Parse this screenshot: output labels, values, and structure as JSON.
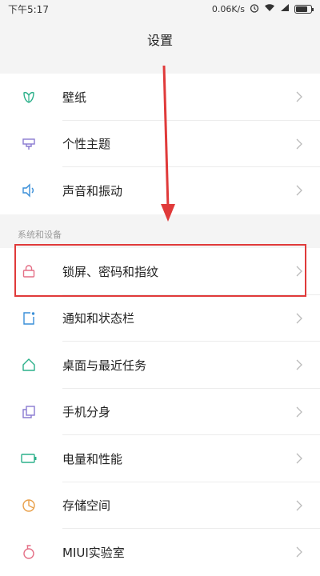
{
  "status_bar": {
    "time": "下午5:17",
    "network_speed": "0.06K/s",
    "alarm_icon": "alarm-icon",
    "wifi_icon": "wifi-icon",
    "signal_icon": "signal-icon",
    "battery_level": 0.85
  },
  "header": {
    "title": "设置"
  },
  "section1": {
    "items": [
      {
        "label": "壁纸",
        "icon": "wallpaper-icon"
      },
      {
        "label": "个性主题",
        "icon": "theme-icon"
      },
      {
        "label": "声音和振动",
        "icon": "sound-icon"
      }
    ]
  },
  "section2": {
    "header": "系统和设备",
    "items": [
      {
        "label": "锁屏、密码和指纹",
        "icon": "lock-icon"
      },
      {
        "label": "通知和状态栏",
        "icon": "notification-icon"
      },
      {
        "label": "桌面与最近任务",
        "icon": "home-icon"
      },
      {
        "label": "手机分身",
        "icon": "dual-apps-icon"
      },
      {
        "label": "电量和性能",
        "icon": "battery-icon"
      },
      {
        "label": "存储空间",
        "icon": "storage-icon"
      },
      {
        "label": "MIUI实验室",
        "icon": "lab-icon"
      }
    ]
  },
  "colors": {
    "accent_green": "#2bb08a",
    "accent_purple": "#8a7bd1",
    "accent_blue": "#3a8fd8",
    "accent_red": "#e46f86",
    "annotation_red": "#e03a3a"
  }
}
